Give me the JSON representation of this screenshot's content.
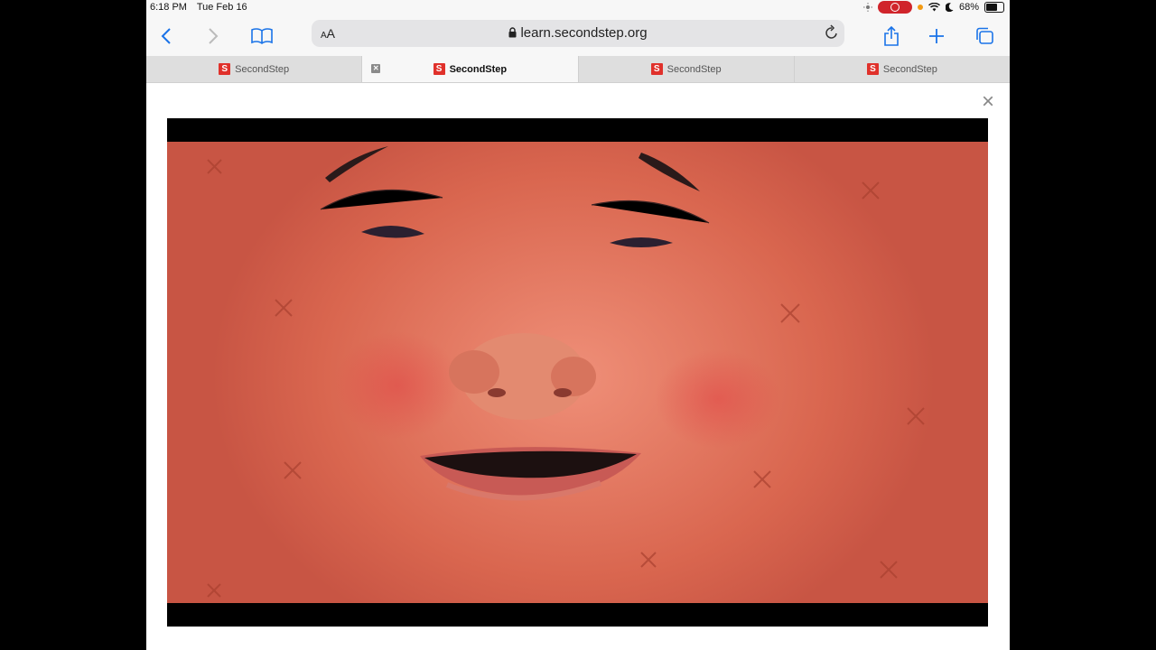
{
  "status_bar": {
    "time": "6:18 PM",
    "date": "Tue Feb 16",
    "battery_percent": "68%",
    "battery_level": 0.68
  },
  "toolbar": {
    "text_size_label_small": "A",
    "text_size_label_large": "A",
    "url": "learn.secondstep.org",
    "accent_color": "#1a73e8"
  },
  "tabs": [
    {
      "title": "SecondStep",
      "active": false
    },
    {
      "title": "SecondStep",
      "active": true
    },
    {
      "title": "SecondStep",
      "active": false
    },
    {
      "title": "SecondStep",
      "active": false
    }
  ],
  "tab_logo_letter": "S",
  "brand_color": "#e0312b",
  "modal": {
    "close_glyph": "×"
  }
}
